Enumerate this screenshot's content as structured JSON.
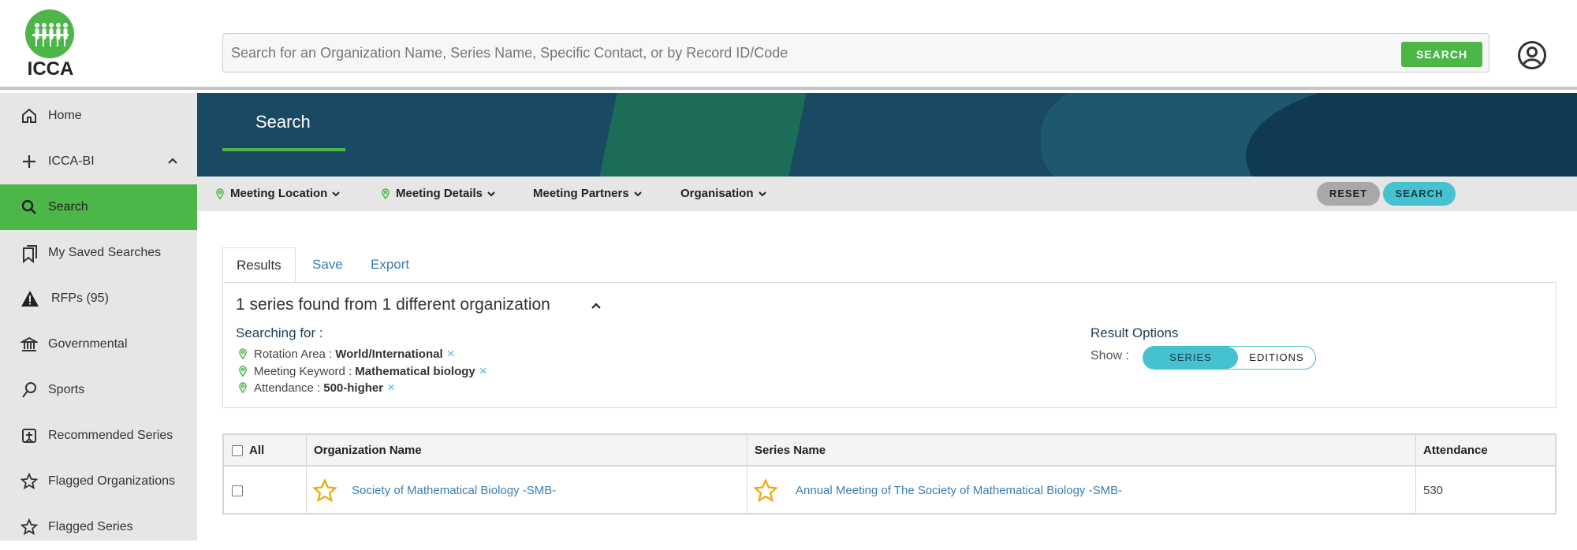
{
  "brand": {
    "logo_text": "ICCA",
    "accent": "#4cb648",
    "teal": "#45c1cf"
  },
  "header": {
    "search_placeholder": "Search for an Organization Name, Series Name, Specific Contact, or by Record ID/Code",
    "search_button": "SEARCH",
    "user_icon": "user-circle-icon"
  },
  "sidebar": {
    "items": [
      {
        "label": "Home",
        "icon": "home-icon"
      },
      {
        "label": "ICCA-BI",
        "icon": "plus-icon"
      },
      {
        "label": "Search",
        "icon": "search-icon",
        "active": true
      },
      {
        "label": "My Saved Searches",
        "icon": "bookmarks-icon"
      },
      {
        "label": "RFPs (95)",
        "icon": "warning-icon"
      },
      {
        "label": "Governmental",
        "icon": "bank-icon"
      },
      {
        "label": "Sports",
        "icon": "sports-icon"
      },
      {
        "label": "Recommended Series",
        "icon": "recommended-icon"
      },
      {
        "label": "Flagged Organizations",
        "icon": "star-icon"
      },
      {
        "label": "Flagged Series",
        "icon": "star-icon"
      }
    ]
  },
  "banner": {
    "title": "Search"
  },
  "filters": {
    "items": [
      "Meeting Location",
      "Meeting Details",
      "Meeting Partners",
      "Organisation"
    ],
    "reset": "RESET",
    "search": "SEARCH"
  },
  "tabs": [
    "Results",
    "Save",
    "Export"
  ],
  "summary": {
    "count_text": "1 series found from 1 different organization",
    "searching_for": "Searching for :",
    "criteria": [
      {
        "label": "Rotation Area :",
        "value": "World/International"
      },
      {
        "label": "Meeting Keyword :",
        "value": "Mathematical biology"
      },
      {
        "label": "Attendance :",
        "value": "500-higher"
      }
    ],
    "remove_glyph": "×",
    "result_options": "Result Options",
    "show_label": "Show :",
    "toggle_on": "SERIES",
    "toggle_off": "EDITIONS"
  },
  "table": {
    "headers": {
      "all": "All",
      "org": "Organization Name",
      "series": "Series Name",
      "attendance": "Attendance"
    },
    "rows": [
      {
        "org": "Society of Mathematical Biology -SMB-",
        "series": "Annual Meeting of The Society of Mathematical Biology -SMB-",
        "attendance": "530"
      }
    ]
  }
}
